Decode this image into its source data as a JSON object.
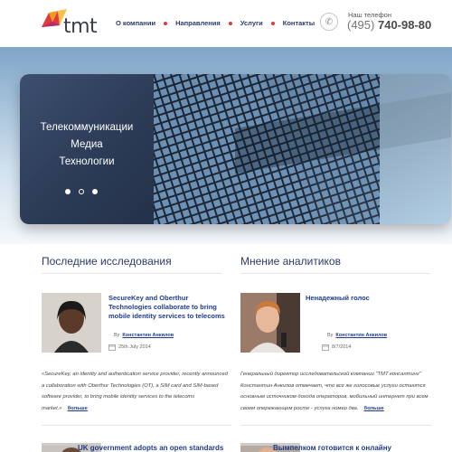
{
  "brand": {
    "name": "tmt",
    "accent_red": "#e03a3a",
    "accent_orange": "#f39a1e",
    "accent_blue": "#2b3b6b"
  },
  "nav": {
    "items": [
      {
        "label": "О компании"
      },
      {
        "label": "Направления"
      },
      {
        "label": "Услуги"
      },
      {
        "label": "Контакты"
      }
    ]
  },
  "contact": {
    "label": "Наш телефон",
    "code": "(495)",
    "number": "740-98-80",
    "icon": "phone-icon"
  },
  "hero": {
    "lines": [
      "Телекоммуникации",
      "Медиа",
      "Технологии"
    ],
    "slides_count": 3,
    "active_slide": 2
  },
  "research": {
    "title": "Последние исследования",
    "articles": [
      {
        "title": "SecureKey and Oberthur Technologies collaborate to bring mobile identity services to telecoms",
        "by": "By",
        "author": "Константин Анкилов",
        "date": "25th July 2014",
        "excerpt": "«SecureKey, an identity and authentication service provider, recently announced a collaboration with Oberthur Technologies (OT), a SIM card and SIM-based software provider, to bring mobile identity services to the telecoms market.»",
        "more": "больше"
      },
      {
        "title": "UK government adopts an open standards"
      }
    ]
  },
  "analysts": {
    "title": "Мнение аналитиков",
    "articles": [
      {
        "title": "Ненадежный голос",
        "by": "By",
        "author": "Константин Анкилов",
        "date": "8/7/2014",
        "excerpt": "Генеральный директор исследовательской компании \"ТМТ консалтинг\" Константин Анкилов отмечает, что все же голосовые услуги остаются основным источником дохода операторов, мобильный интернет при всем своем опережающем росте - услуга номер два.",
        "more": "больше"
      },
      {
        "title": "Вымпелком готовится к онлайну"
      }
    ]
  }
}
